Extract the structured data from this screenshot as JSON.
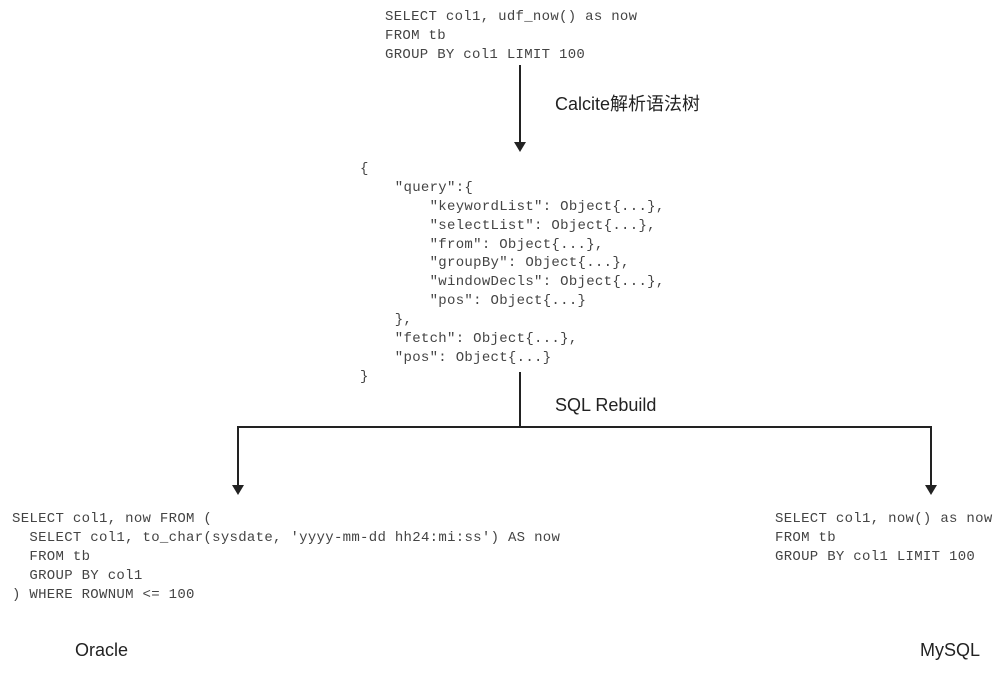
{
  "source_sql": "SELECT col1, udf_now() as now\nFROM tb\nGROUP BY col1 LIMIT 100",
  "labels": {
    "parse": "Calcite解析语法树",
    "rebuild": "SQL Rebuild"
  },
  "ast_json": "{\n    \"query\":{\n        \"keywordList\": Object{...},\n        \"selectList\": Object{...},\n        \"from\": Object{...},\n        \"groupBy\": Object{...},\n        \"windowDecls\": Object{...},\n        \"pos\": Object{...}\n    },\n    \"fetch\": Object{...},\n    \"pos\": Object{...}\n}",
  "oracle_sql": "SELECT col1, now FROM (\n  SELECT col1, to_char(sysdate, 'yyyy-mm-dd hh24:mi:ss') AS now\n  FROM tb\n  GROUP BY col1\n) WHERE ROWNUM <= 100",
  "mysql_sql": "SELECT col1, now() as now\nFROM tb\nGROUP BY col1 LIMIT 100",
  "db_labels": {
    "oracle": "Oracle",
    "mysql": "MySQL"
  }
}
